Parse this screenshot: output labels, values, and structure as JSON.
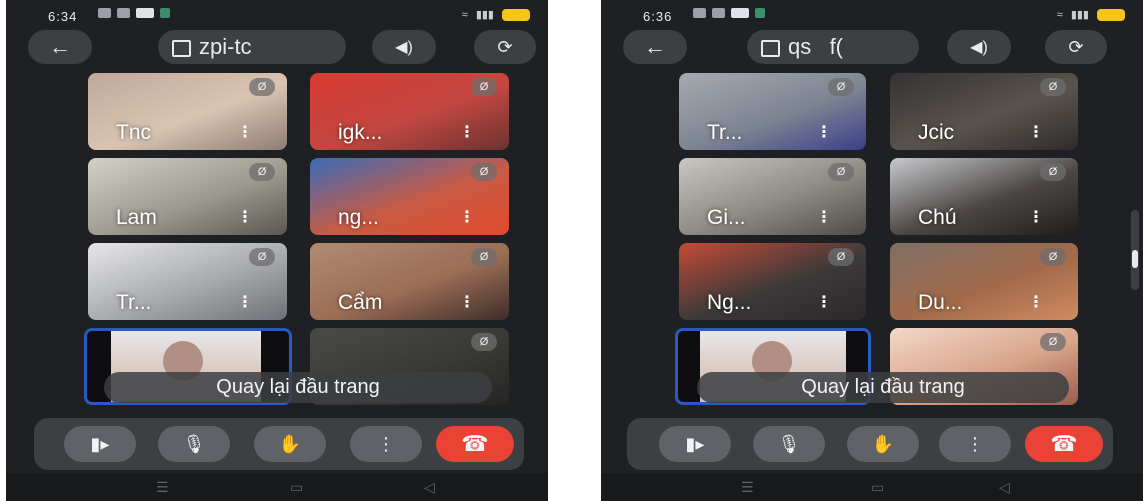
{
  "screens": [
    {
      "status_time": "6:34",
      "meeting_code": "zpi-tc",
      "participants": [
        {
          "name": "Tnc",
          "colors": [
            "#bfa999",
            "#d9c4b2",
            "#8f7d73"
          ]
        },
        {
          "name": "igk...",
          "colors": [
            "#d93a32",
            "#c24740",
            "#6b3330"
          ]
        },
        {
          "name": "Lam",
          "colors": [
            "#d3d0c8",
            "#9d9a90",
            "#5a5750"
          ]
        },
        {
          "name": "ng...",
          "colors": [
            "#3a6bb8",
            "#c95b45",
            "#e04a2d"
          ]
        },
        {
          "name": "Tr...",
          "colors": [
            "#e6e6e8",
            "#a8aaae",
            "#6f7176"
          ]
        },
        {
          "name": "Cẩm",
          "colors": [
            "#b08b73",
            "#9b6d55",
            "#3e2d2a"
          ]
        },
        {
          "name": "",
          "colors": [
            "#4a4a48",
            "#3a3936",
            "#262523"
          ]
        }
      ],
      "back_to_top_label": "Quay lại đầu trang"
    },
    {
      "status_time": "6:36",
      "meeting_code": "qs   f(",
      "participants": [
        {
          "name": "Tr...",
          "colors": [
            "#a7a9ae",
            "#7d8592",
            "#3c3f8a"
          ]
        },
        {
          "name": "Jcic",
          "colors": [
            "#343232",
            "#5a534d",
            "#2e2c2b"
          ]
        },
        {
          "name": "Gi...",
          "colors": [
            "#c9c7c1",
            "#8c8a82",
            "#4e4b46"
          ]
        },
        {
          "name": "Chú",
          "colors": [
            "#c7c9cc",
            "#4c4745",
            "#1f1d1c"
          ]
        },
        {
          "name": "Ng...",
          "colors": [
            "#c54a36",
            "#3c3a39",
            "#2a2928"
          ]
        },
        {
          "name": "Du...",
          "colors": [
            "#7f6f66",
            "#a26a4a",
            "#cf8b62"
          ]
        },
        {
          "name": "",
          "colors": [
            "#f2d7c8",
            "#d9a48a",
            "#9a5d4c"
          ]
        }
      ],
      "back_to_top_label": "Quay lại đầu trang"
    }
  ],
  "colors": {
    "background": "#1f2023",
    "pill": "#3c4043",
    "button": "#5f6368",
    "hangup": "#ea4335",
    "self_border": "#2a59c4"
  },
  "icons": {
    "back": "arrow-left-icon",
    "calendar": "calendar-icon",
    "speaker": "speaker-icon",
    "switch_camera": "switch-camera-icon",
    "camera": "video-camera-icon",
    "mic": "microphone-icon",
    "hand": "raise-hand-icon",
    "more": "more-vert-icon",
    "hangup": "phone-hangup-icon",
    "mute": "mic-off-icon"
  }
}
